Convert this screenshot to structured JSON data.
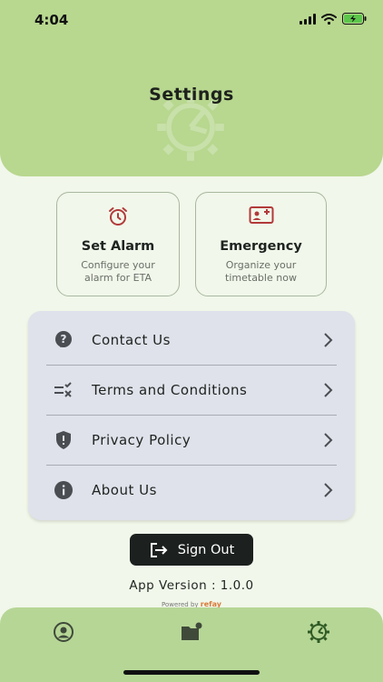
{
  "status_bar": {
    "time": "4:04"
  },
  "header": {
    "title": "Settings"
  },
  "cards": [
    {
      "title": "Set Alarm",
      "subtitle": "Configure your alarm for ETA",
      "icon": "alarm-clock-icon"
    },
    {
      "title": "Emergency",
      "subtitle": "Organize your timetable now",
      "icon": "id-card-icon"
    }
  ],
  "menu": {
    "items": [
      {
        "label": "Contact Us",
        "icon": "help-circle-icon"
      },
      {
        "label": "Terms and Conditions",
        "icon": "checklist-icon"
      },
      {
        "label": "Privacy Policy",
        "icon": "shield-icon"
      },
      {
        "label": "About Us",
        "icon": "info-icon"
      }
    ]
  },
  "sign_out": {
    "label": "Sign Out"
  },
  "footer": {
    "version": "App Version : 1.0.0",
    "powered_prefix": "Powered by",
    "powered_brand": "refay"
  },
  "tabbar": {
    "tabs": [
      "profile-icon",
      "folder-icon",
      "settings-gear-icon"
    ],
    "active": "settings-gear-icon"
  },
  "colors": {
    "header_bg": "#b8d78f",
    "page_bg": "#f1f7ea",
    "accent_red": "#b23a3a",
    "tabbar_bg": "#b6d696",
    "menu_bg": "#dfe2ea"
  }
}
